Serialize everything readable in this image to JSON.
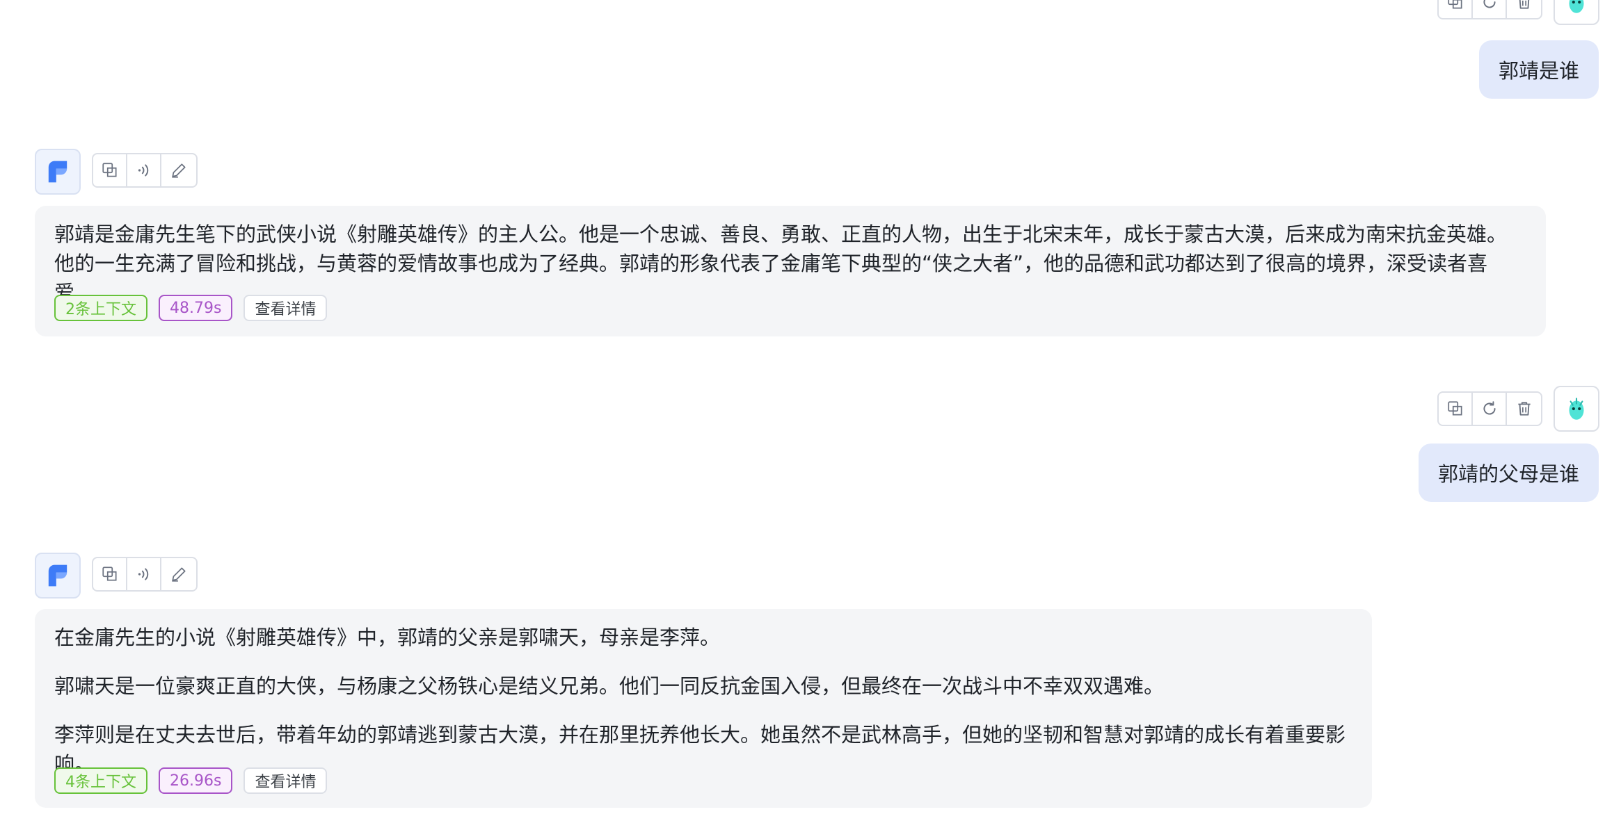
{
  "conversation": {
    "messages": [
      {
        "role": "user",
        "text": "郭靖是谁"
      },
      {
        "role": "assistant",
        "paragraphs": [
          "郭靖是金庸先生笔下的武侠小说《射雕英雄传》的主人公。他是一个忠诚、善良、勇敢、正直的人物，出生于北宋末年，成长于蒙古大漠，后来成为南宋抗金英雄。他的一生充满了冒险和挑战，与黄蓉的爱情故事也成为了经典。郭靖的形象代表了金庸笔下典型的“侠之大者”，他的品德和武功都达到了很高的境界，深受读者喜爱。"
        ],
        "context_tag": "2条上下文",
        "time_tag": "48.79s",
        "detail_button": "查看详情"
      },
      {
        "role": "user",
        "text": "郭靖的父母是谁"
      },
      {
        "role": "assistant",
        "paragraphs": [
          "在金庸先生的小说《射雕英雄传》中，郭靖的父亲是郭啸天，母亲是李萍。",
          "郭啸天是一位豪爽正直的大侠，与杨康之父杨铁心是结义兄弟。他们一同反抗金国入侵，但最终在一次战斗中不幸双双遇难。",
          "李萍则是在丈夫去世后，带着年幼的郭靖逃到蒙古大漠，并在那里抚养他长大。她虽然不是武林高手，但她的坚韧和智慧对郭靖的成长有着重要影响。"
        ],
        "context_tag": "4条上下文",
        "time_tag": "26.96s",
        "detail_button": "查看详情"
      }
    ]
  },
  "icons": {
    "user_actions": [
      "copy-icon",
      "regenerate-icon",
      "delete-icon"
    ],
    "assistant_actions": [
      "copy-icon",
      "speaker-icon",
      "edit-icon"
    ],
    "assistant_avatar": "assistant-logo-icon",
    "user_avatar": "user-avatar-icon"
  },
  "colors": {
    "user_bubble": "#e2e9fb",
    "assistant_bubble": "#f4f5f7",
    "context_tag": "#67c23a",
    "time_tag": "#a855c8",
    "accent_blue": "#3d7bf7"
  }
}
